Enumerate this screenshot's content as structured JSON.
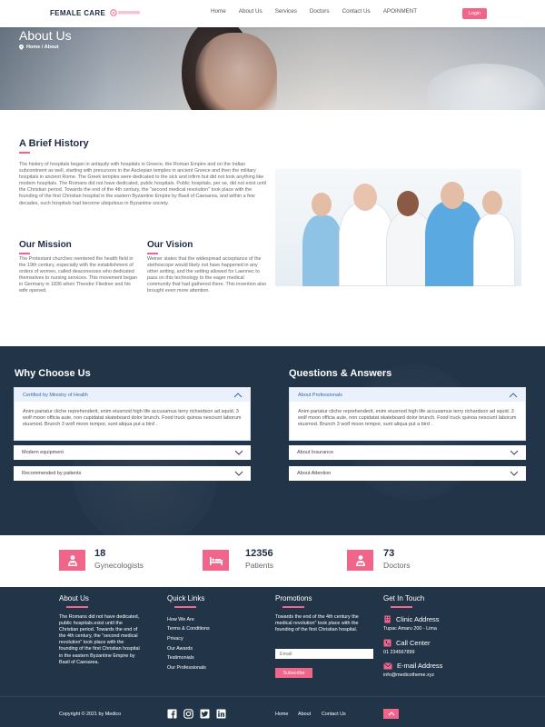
{
  "nav": {
    "brand": "FEMALE CARE",
    "links": [
      "Home",
      "About Us",
      "Services",
      "Doctors",
      "Contact Us",
      "APOINMENT"
    ],
    "login": "Login"
  },
  "hero": {
    "title": "About Us",
    "breadcrumb": "Home / About"
  },
  "history": {
    "title": "A Brief History",
    "text": "The history of hospitals began in antiquity with hospitals in Greece, the Roman Empire and on the Indian subcontinent as well, starting with precursors in the Asclepian temples in ancient Greece and then the military hospitals in ancient Rome. The Greek temples were dedicated to the sick and infirm but did not took anything like modern hospitals. The Romans did not have dedicated, public hospitals. Public hospitals, per se, did not exist until the Christian period. Towards the end of the 4th century, the \"second medical revolution\" took place with the founding of the first Christian hospital in the eastern Byzantine Empire by Basil of Caesarea, and within a few decades, such hospitals had become ubiquitous in Byzantine society."
  },
  "mission": {
    "title": "Our Mission",
    "text": "The Protestant churches reentered the health field in the 19th century, especially with the establishment of orders of women, called deaconesses who dedicated themselves to nursing services. This movement began in Germany in 1836 when Theodor Fliedner and his wife opened."
  },
  "vision": {
    "title": "Our Vision",
    "text": "Weiner states that the widespread acceptance of the stethoscope would likely not have happened in any other setting, and the setting allowed for Laennec to pass on this technology to the eager medical community that had gathered there. This invention also brought even more attention."
  },
  "why": {
    "title": "Why Choose Us",
    "open_item": "Certified by Ministry of Health",
    "open_text": "Anim pariatur cliche reprehenderit, enim eiusmod high life accusamus terry richardson ad squid. 3 wolf moon officia aute, non cupidatat skateboard dolor brunch. Food truck quinoa nesciunt laborum eiusmod. Brunch 3 wolf moon tempor, sunt aliqua put a bird .",
    "items": [
      "Modern equipment",
      "Recommended by patients"
    ]
  },
  "qa": {
    "title": "Questions & Answers",
    "open_item": "About Professionals",
    "open_text": "Anim pariatur cliche reprehenderit, enim eiusmod high life accusamus terry richardson ad squid. 3 wolf moon officia aute, non cupidatat skateboard dolor brunch. Food truck quinoa nesciunt laborum eiusmod. Brunch 3 wolf moon tempor, sunt aliqua put a bird .",
    "items": [
      "About Insurance",
      "About Attention"
    ]
  },
  "stats": [
    {
      "value": "18",
      "label": "Gynecologists"
    },
    {
      "value": "12356",
      "label": "Patients"
    },
    {
      "value": "73",
      "label": "Doctors"
    }
  ],
  "footer": {
    "about_title": "About Us",
    "about_text": "The Romans did not have dedicated, public hospitals.exist until the Christian period. Towards the end of the 4th century, the \"second medical revolution\" took place with the founding of the first Christian hospital in the eastern Byzantine Empire by Basil of Caesarea.",
    "links_title": "Quick Links",
    "links": [
      "How We Are",
      "Terms & Conditions",
      "Privacy",
      "Our Awards",
      "Testimonials",
      "Our Professionals"
    ],
    "promo_title": "Promotions",
    "promo_text": "Towards the end of the 4th century the medical revolution\" took place with the founding of the first Christian hospital.",
    "email_placeholder": "Email",
    "subscribe": "Subscribe",
    "touch_title": "Get In Touch",
    "clinic_label": "Clinic Address",
    "clinic_value": "Tupac Amaru 200 - Lima",
    "call_label": "Call Center",
    "call_value": "01 234567899",
    "email_label": "E-mail Address",
    "email_value": "info@medicotheme.xyz",
    "copyright": "Copyright © 2021 by Medico",
    "bottom_links": [
      "Home",
      "About",
      "Contact Us"
    ]
  },
  "colors": {
    "accent": "#f2658b",
    "navy": "#223448",
    "heading": "#1e2b44"
  }
}
